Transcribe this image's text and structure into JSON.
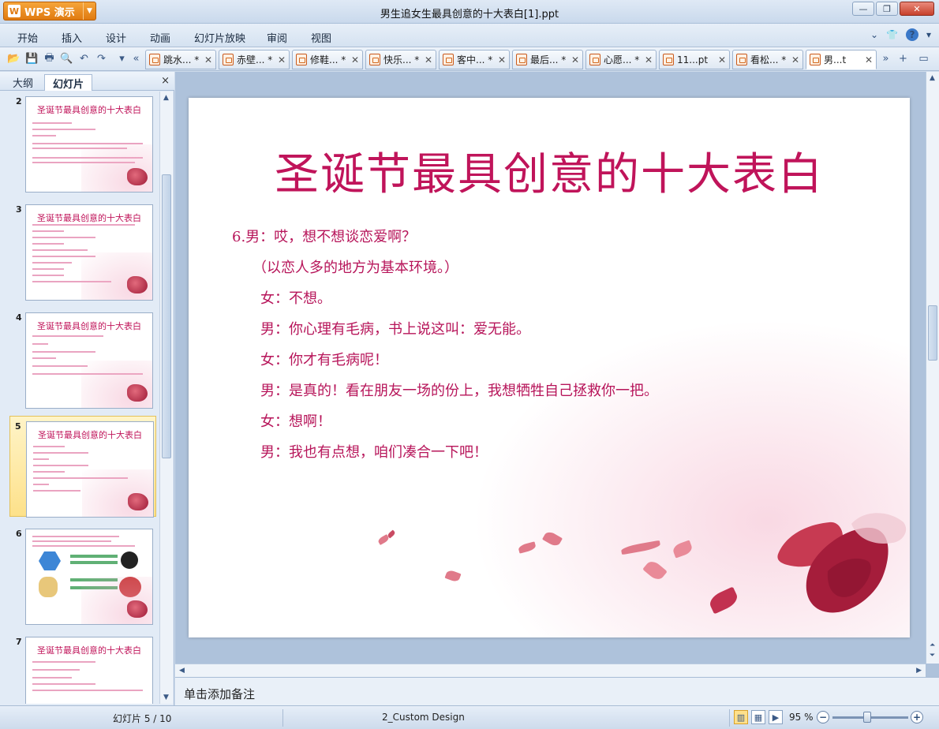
{
  "app": {
    "button_label": "WPS 演示",
    "window_title": "男生追女生最具创意的十大表白[1].ppt"
  },
  "menu": [
    "开始",
    "插入",
    "设计",
    "动画",
    "幻灯片放映",
    "审阅",
    "视图"
  ],
  "doc_tabs": [
    {
      "label": "跳水... *"
    },
    {
      "label": "赤壁... *"
    },
    {
      "label": "修鞋... *"
    },
    {
      "label": "快乐... *"
    },
    {
      "label": "客中... *"
    },
    {
      "label": "最后... *"
    },
    {
      "label": "心愿... *"
    },
    {
      "label": "11...pt"
    },
    {
      "label": "看松... *"
    },
    {
      "label": "男...t"
    }
  ],
  "left_panel": {
    "tab_outline": "大纲",
    "tab_slides": "幻灯片",
    "close": "×",
    "thumbnails": [
      {
        "num": "2",
        "title": "圣诞节最具创意的十大表白"
      },
      {
        "num": "3",
        "title": "圣诞节最具创意的十大表白"
      },
      {
        "num": "4",
        "title": "圣诞节最具创意的十大表白"
      },
      {
        "num": "5",
        "title": "圣诞节最具创意的十大表白"
      },
      {
        "num": "6",
        "title": ""
      },
      {
        "num": "7",
        "title": "圣诞节最具创意的十大表白"
      }
    ]
  },
  "slide": {
    "title": "圣诞节最具创意的十大表白",
    "lines": [
      "6.男：哎，想不想谈恋爱啊？",
      "（以恋人多的地方为基本环境。）",
      "女：不想。",
      "男：你心理有毛病，书上说这叫：爱无能。",
      "女：你才有毛病呢！",
      "男：是真的！看在朋友一场的份上，我想牺牲自己拯救你一把。",
      "女：想啊！",
      "男：我也有点想，咱们凑合一下吧！"
    ]
  },
  "notes": {
    "placeholder": "单击添加备注"
  },
  "status": {
    "slide_counter": "幻灯片 5 / 10",
    "design": "2_Custom Design",
    "zoom": "95 %"
  },
  "colors": {
    "title": "#c0145a",
    "accent": "#e07a10"
  }
}
